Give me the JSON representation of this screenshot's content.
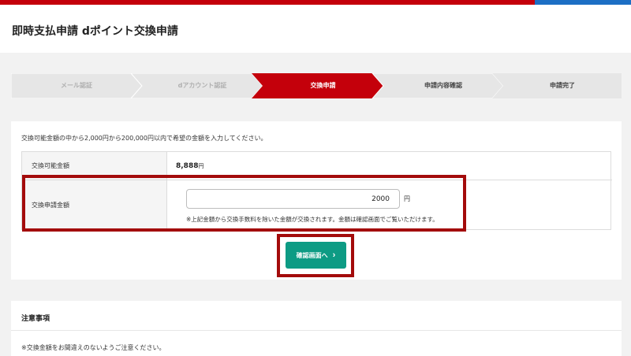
{
  "header": {
    "title": "即時支払申請 dポイント交換申請"
  },
  "steps": [
    {
      "label": "メール認証",
      "state": "done"
    },
    {
      "label": "dアカウント認証",
      "state": "done"
    },
    {
      "label": "交換申請",
      "state": "active"
    },
    {
      "label": "申請内容確認",
      "state": "pending"
    },
    {
      "label": "申請完了",
      "state": "pending"
    }
  ],
  "form": {
    "intro": "交換可能金額の中から2,000円から200,000円以内で希望の金額を入力してください。",
    "available_label": "交換可能金額",
    "available_value": "8,888",
    "available_unit": "円",
    "request_label": "交換申請金額",
    "request_value": "2000",
    "unit": "円",
    "note": "※上記金額から交換手数料を除いた金額が交換されます。金額は確認画面でご覧いただけます。",
    "confirm_button": "確認画面へ",
    "confirm_arrow": "›"
  },
  "notes": {
    "title": "注意事項",
    "body": "※交換金額をお間違えのないようご注意ください。"
  },
  "colors": {
    "brand_red": "#c4000b",
    "top_blue": "#1c6fc4",
    "button_teal": "#0d9b84",
    "highlight": "#a30b0b"
  }
}
